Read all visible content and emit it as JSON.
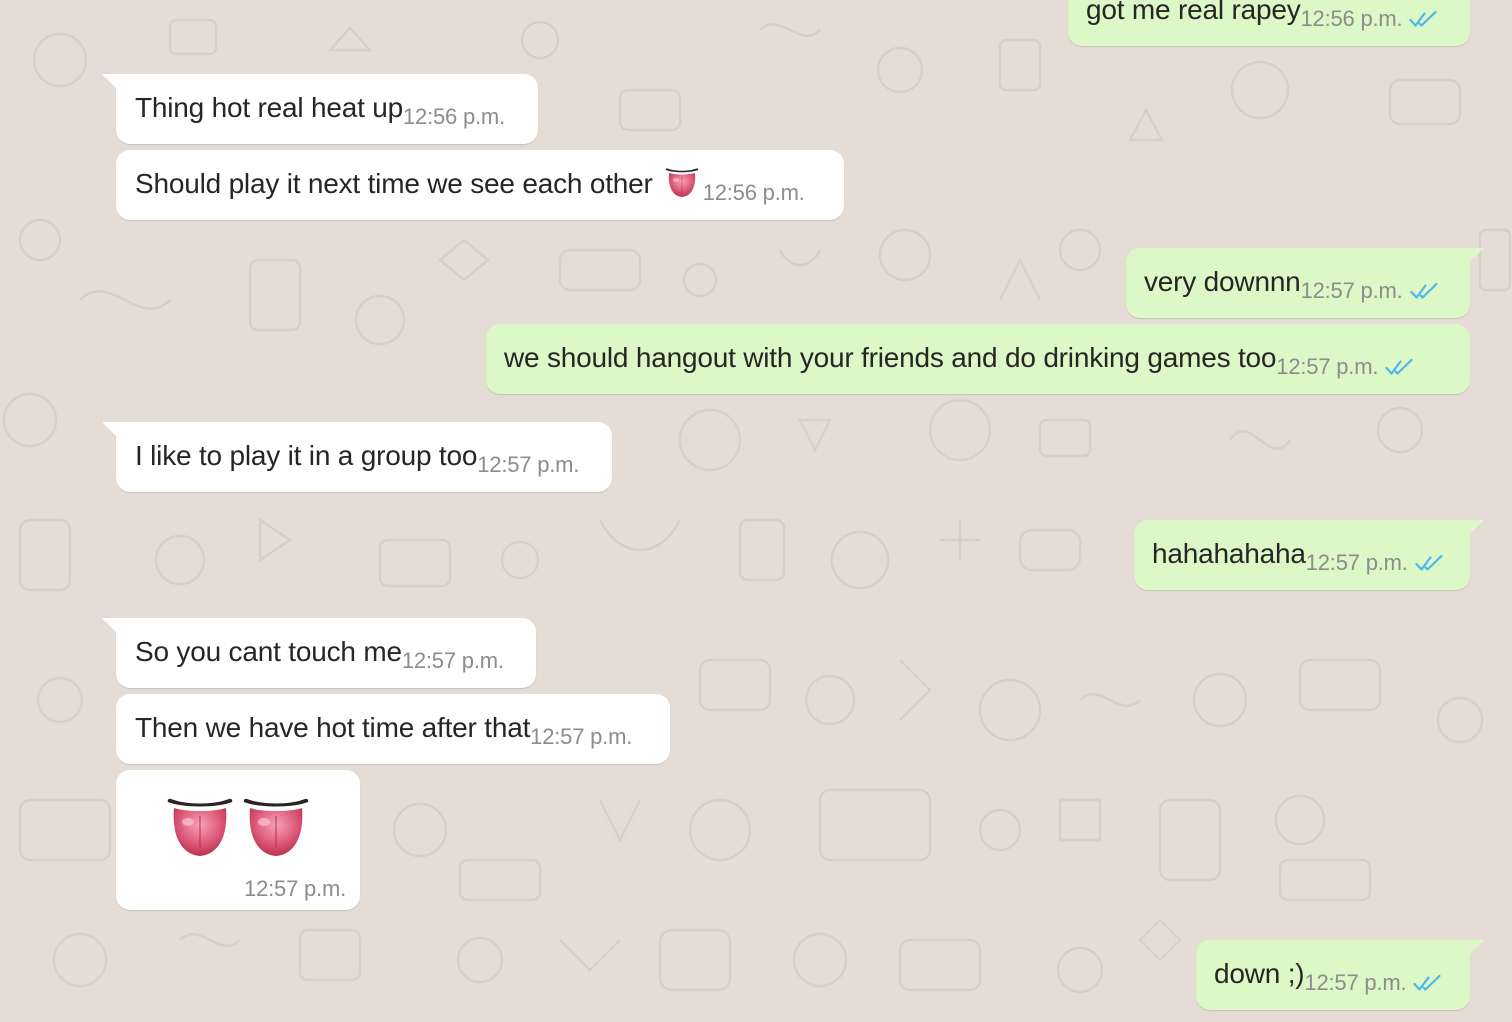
{
  "colors": {
    "wallpaper": "#e5ddd5",
    "incoming_bubble": "#ffffff",
    "outgoing_bubble": "#dcf8c6",
    "timestamp": "#8c8c8c",
    "read_ticks": "#4fb6ec",
    "text": "#262626"
  },
  "messages": [
    {
      "direction": "out",
      "text": "got me real rapey",
      "time": "12:56 p.m.",
      "status_icon": "double-check-read-icon"
    },
    {
      "direction": "in",
      "text": "Thing hot real heat up",
      "time": "12:56 p.m."
    },
    {
      "direction": "in",
      "text": "Should play it next time we see each other",
      "time": "12:56 p.m.",
      "emoji": "tongue-emoji"
    },
    {
      "direction": "out",
      "text": "very downnn",
      "time": "12:57 p.m.",
      "status_icon": "double-check-read-icon"
    },
    {
      "direction": "out",
      "text": "we should hangout with your friends and do drinking games too",
      "time": "12:57 p.m.",
      "status_icon": "double-check-read-icon"
    },
    {
      "direction": "in",
      "text": "I like to play it in a group too",
      "time": "12:57 p.m."
    },
    {
      "direction": "out",
      "text": "hahahahaha",
      "time": "12:57 p.m.",
      "status_icon": "double-check-read-icon"
    },
    {
      "direction": "in",
      "text": "So you cant touch me",
      "time": "12:57 p.m."
    },
    {
      "direction": "in",
      "text": "Then we have hot time after that",
      "time": "12:57 p.m."
    },
    {
      "direction": "in",
      "type": "emoji-only",
      "emojis": [
        "tongue-emoji",
        "tongue-emoji"
      ],
      "time": "12:57 p.m."
    },
    {
      "direction": "out",
      "text": "down ;)",
      "time": "12:57 p.m.",
      "status_icon": "double-check-read-icon"
    }
  ]
}
